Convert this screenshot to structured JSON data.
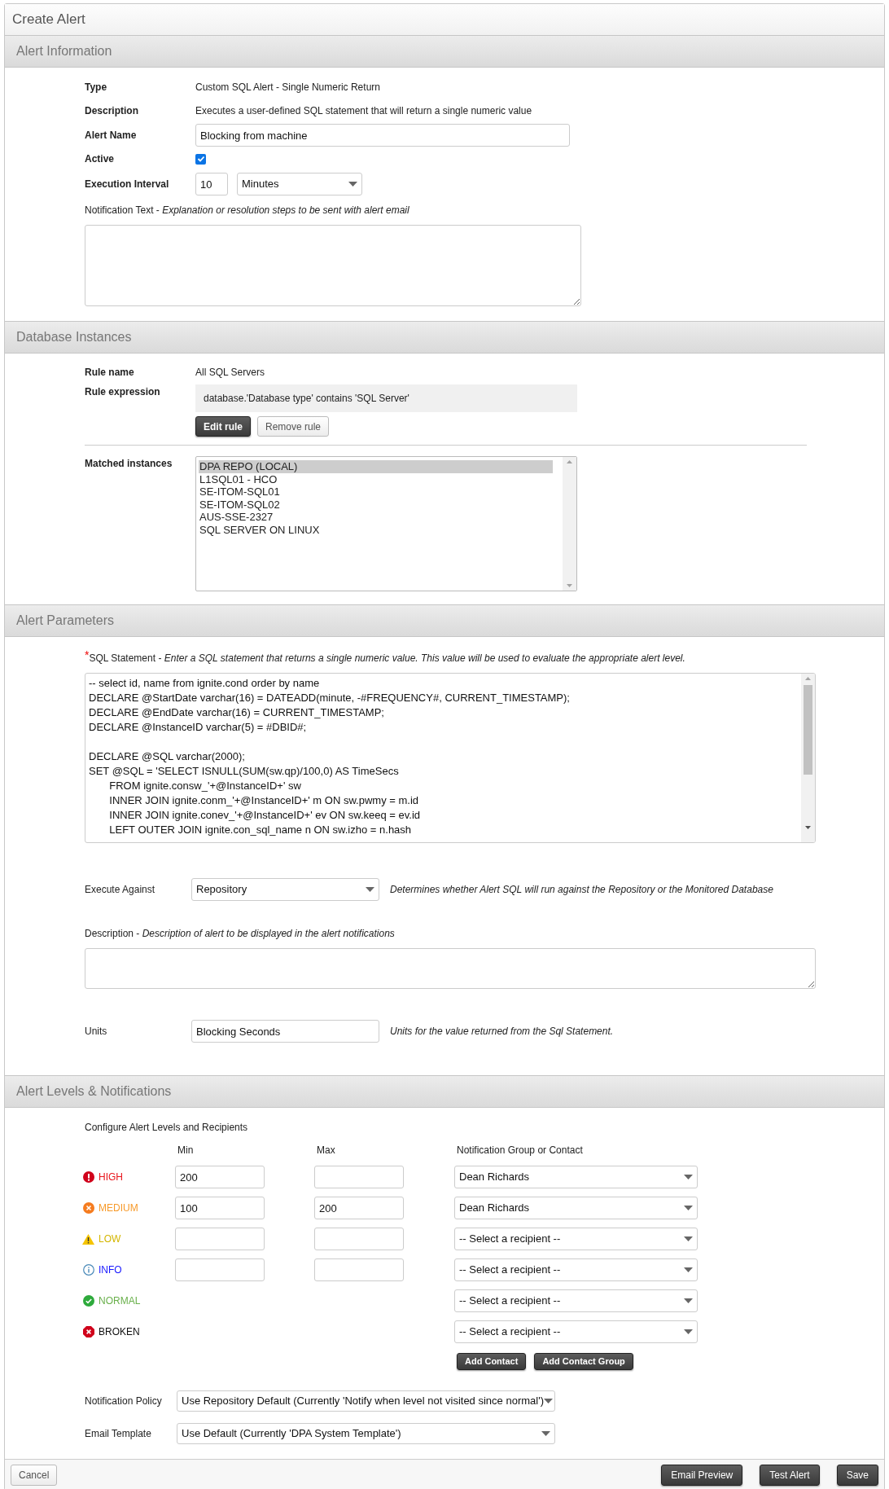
{
  "page_title": "Create Alert",
  "alert_information": {
    "title": "Alert Information",
    "type": {
      "label": "Type",
      "value": "Custom SQL Alert - Single Numeric Return"
    },
    "description": {
      "label": "Description",
      "value": "Executes a user-defined SQL statement that will return a single numeric value"
    },
    "alert_name": {
      "label": "Alert Name",
      "value": "Blocking from machine"
    },
    "active": {
      "label": "Active",
      "checked": true
    },
    "execution_interval": {
      "label": "Execution Interval",
      "value": "10",
      "unit": "Minutes"
    },
    "notification_text": {
      "label": "Notification Text - *Explanation or resolution steps to be sent with alert email*"
    }
  },
  "database_instances": {
    "title": "Database Instances",
    "rule_name": {
      "label": "Rule name",
      "value": "All SQL Servers"
    },
    "rule_expression": {
      "label": "Rule expression",
      "value": "database.'Database type' contains 'SQL Server'"
    },
    "buttons": [
      {
        "kind": "primary",
        "label": "Edit rule"
      },
      {
        "kind": "secondary",
        "label": "Remove rule"
      }
    ],
    "matched_instances": {
      "label": "Matched instances",
      "items": [
        {
          "text": "DPA REPO (LOCAL)",
          "selected": true
        },
        {
          "text": "L1SQL01 - HCO",
          "selected": false
        },
        {
          "text": "SE-ITOM-SQL01",
          "selected": false
        },
        {
          "text": "SE-ITOM-SQL02",
          "selected": false
        },
        {
          "text": "AUS-SSE-2327",
          "selected": false
        },
        {
          "text": "SQL SERVER ON LINUX",
          "selected": false
        }
      ]
    }
  },
  "alert_parameters": {
    "title": "Alert Parameters",
    "sql_statement": {
      "required_mark": "*",
      "label": "SQL Statement - *Enter a SQL statement that returns a single numeric value. This value will be used to evaluate the appropriate alert level.*",
      "value": "-- select id, name from ignite.cond order by name\nDECLARE @StartDate varchar(16) = DATEADD(minute, -#FREQUENCY#, CURRENT_TIMESTAMP);\nDECLARE @EndDate varchar(16) = CURRENT_TIMESTAMP;\nDECLARE @InstanceID varchar(5) = #DBID#;\n\nDECLARE @SQL varchar(2000);\nSET @SQL = 'SELECT ISNULL(SUM(sw.qp)/100,0) AS TimeSecs\n       FROM ignite.consw_'+@InstanceID+' sw\n       INNER JOIN ignite.conm_'+@InstanceID+' m ON sw.pwmy = m.id\n       INNER JOIN ignite.conev_'+@InstanceID+' ev ON sw.keeq = ev.id\n       LEFT OUTER JOIN ignite.con_sql_name n ON sw.izho = n.hash"
    },
    "execute_against": {
      "label": "Execute Against",
      "value": "Repository",
      "note": "Determines whether Alert SQL will run against the Repository or the Monitored Database"
    },
    "description": {
      "label": "Description - *Description of alert to be displayed in the alert notifications*"
    },
    "units": {
      "label": "Units",
      "value": "Blocking Seconds",
      "note": "Units for the value returned from the Sql Statement."
    }
  },
  "alert_levels": {
    "title": "Alert Levels & Notifications",
    "subtitle": "Configure Alert Levels and Recipients",
    "columns": [
      "Min",
      "Max",
      "Notification Group or Contact"
    ],
    "levels": [
      {
        "kind": "high",
        "label": "HIGH",
        "color": "#e8141b",
        "has_range": true,
        "min": "200",
        "recipient": "Dean Richards"
      },
      {
        "kind": "medium",
        "label": "MEDIUM",
        "color": "#f79a2a",
        "has_range": true,
        "min": "100",
        "max": "200",
        "recipient": "Dean Richards"
      },
      {
        "kind": "low",
        "label": "LOW",
        "color": "#d4b600",
        "has_range": true,
        "recipient": "-- Select a recipient --"
      },
      {
        "kind": "info",
        "label": "INFO",
        "color": "#1a1aff",
        "has_range": true,
        "recipient": "-- Select a recipient --"
      },
      {
        "kind": "normal",
        "label": "NORMAL",
        "color": "#6ab04c",
        "has_range": false,
        "recipient": "-- Select a recipient --"
      },
      {
        "kind": "broken",
        "label": "BROKEN",
        "color": "#111111",
        "has_range": false,
        "recipient": "-- Select a recipient --"
      }
    ],
    "buttons": [
      "Add Contact",
      "Add Contact Group"
    ],
    "notification_policy": {
      "label": "Notification Policy",
      "value": "Use Repository Default (Currently 'Notify when level not visited since normal')"
    },
    "email_template": {
      "label": "Email Template",
      "value": "Use Default (Currently 'DPA System Template')"
    }
  },
  "footer": {
    "cancel": "Cancel",
    "actions": [
      "Email Preview",
      "Test Alert",
      "Save"
    ]
  }
}
